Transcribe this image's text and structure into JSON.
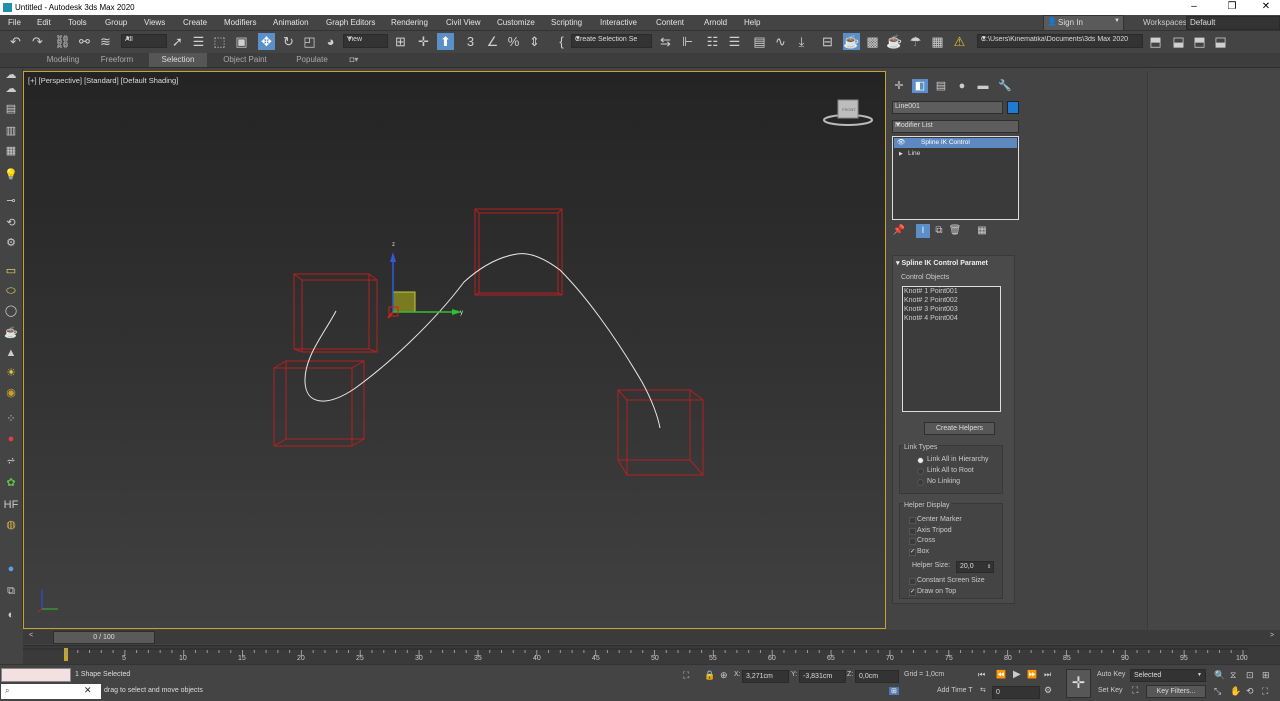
{
  "window": {
    "title": "Untitled - Autodesk 3ds Max 2020",
    "minimize": "–",
    "maximize": "❐",
    "close": "✕"
  },
  "menu": [
    "File",
    "Edit",
    "Tools",
    "Group",
    "Views",
    "Create",
    "Modifiers",
    "Animation",
    "Graph Editors",
    "Rendering",
    "Civil View",
    "Customize",
    "Scripting",
    "Interactive",
    "Content",
    "Arnold",
    "Help"
  ],
  "account": {
    "sign_in": "Sign In",
    "workspaces_label": "Workspaces:",
    "workspace": "Default"
  },
  "toolbar": {
    "filter": "All",
    "ref_coord": "View",
    "selection_set": "Create Selection Se",
    "project_path": "C:\\Users\\Kinematika\\Documents\\3ds Max 2020"
  },
  "ribbon_tabs": [
    "Modeling",
    "Freeform",
    "Selection",
    "Object Paint",
    "Populate"
  ],
  "viewport": {
    "label": "[+] [Perspective] [Standard] [Default Shading]",
    "gizmo": {
      "z": "z",
      "y": "y"
    },
    "viewcube": "FRONT"
  },
  "command_panel": {
    "object_name": "Line001",
    "object_color": "#1e7ad2",
    "modifier_list": "Modifier List",
    "stack": [
      "Spline IK Control",
      "Line"
    ],
    "rollout_title": "Spline IK Control Paramet",
    "control_objects_label": "Control Objects",
    "knots": [
      "Knot#  1  Point001",
      "Knot#  2  Point002",
      "Knot#  3  Point003",
      "Knot#  4  Point004"
    ],
    "create_helpers": "Create Helpers",
    "link_types": {
      "title": "Link Types",
      "options": [
        "Link All in Hierarchy",
        "Link All to Root",
        "No Linking"
      ],
      "selected": 0
    },
    "helper_display": {
      "title": "Helper Display",
      "options": [
        {
          "label": "Center Marker",
          "checked": false
        },
        {
          "label": "Axis Tripod",
          "checked": false
        },
        {
          "label": "Cross",
          "checked": false
        },
        {
          "label": "Box",
          "checked": true
        }
      ],
      "size_label": "Helper Size:",
      "size_value": "20,0",
      "constant": {
        "label": "Constant Screen Size",
        "checked": false
      },
      "draw_on_top": {
        "label": "Draw on Top",
        "checked": true
      }
    }
  },
  "timeline": {
    "frame": "0 / 100",
    "ticks": [
      "5",
      "10",
      "15",
      "20",
      "25",
      "30",
      "35",
      "40",
      "45",
      "50",
      "55",
      "60",
      "65",
      "70",
      "75",
      "80",
      "85",
      "90",
      "95",
      "100"
    ]
  },
  "status": {
    "selected": "1 Shape Selected",
    "prompt": "drag to select and move objects",
    "x_label": "X:",
    "x": "3,271cm",
    "y_label": "Y:",
    "y": "-3,831cm",
    "z_label": "Z:",
    "z": "0,0cm",
    "grid": "Grid = 1,0cm",
    "add_time": "Add Time T",
    "auto_key": "Auto Key",
    "set_key": "Set Key",
    "key_mode": "Selected",
    "key_filters": "Key Filters...",
    "current_frame": "0"
  },
  "colors": {
    "selection_blue": "#5b8fc7",
    "viewport_border": "#c8a32e",
    "helper_box": "#b52020"
  }
}
